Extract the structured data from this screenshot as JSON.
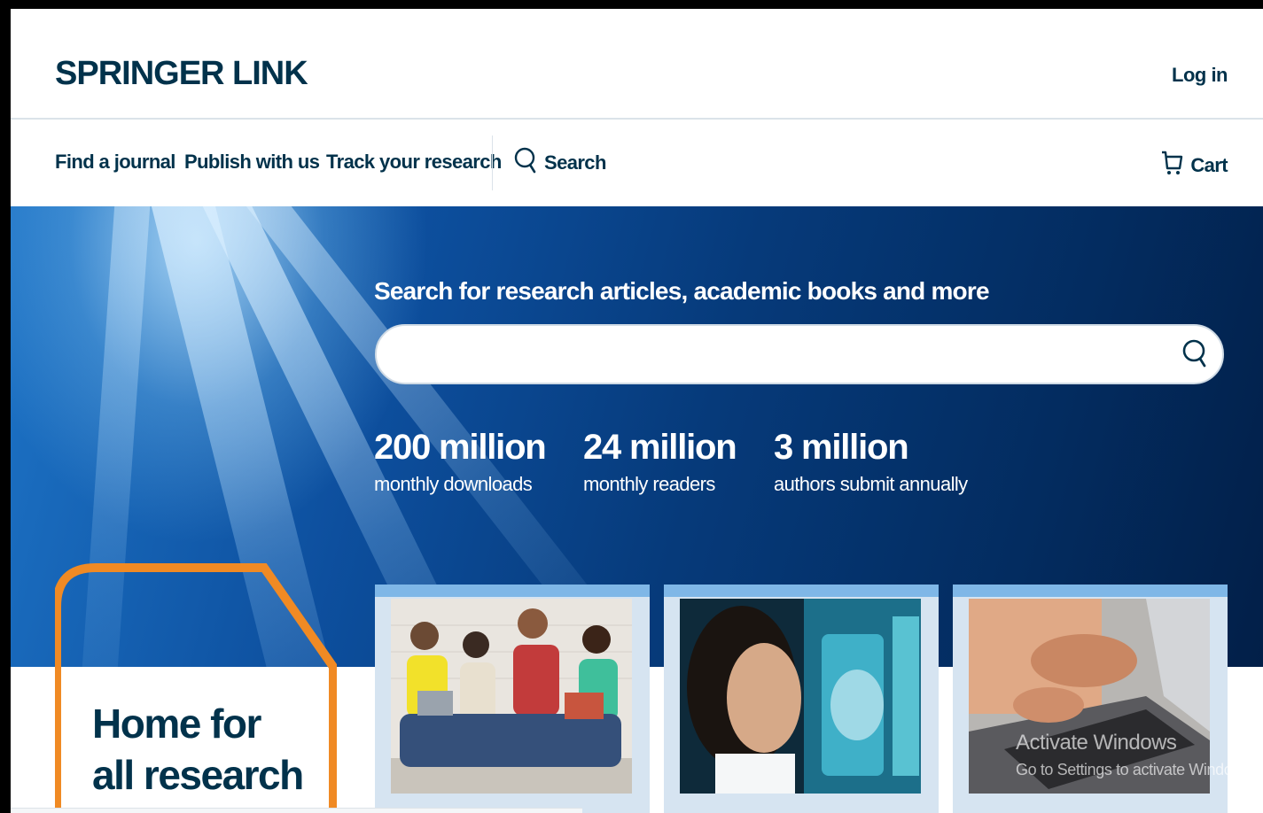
{
  "header": {
    "logo_main": "SPRINGER LINK",
    "login": "Log in"
  },
  "nav": {
    "items": [
      {
        "label": "Find a journal"
      },
      {
        "label": "Publish with us"
      },
      {
        "label": "Track your research"
      }
    ],
    "search_label": "Search",
    "cart_label": "Cart"
  },
  "hero": {
    "title": "Search for research articles, academic books and more",
    "search_value": "",
    "search_placeholder": "",
    "stats": [
      {
        "number": "200 million",
        "label": "monthly downloads"
      },
      {
        "number": "24 million",
        "label": "monthly readers"
      },
      {
        "number": "3 million",
        "label": "authors submit annually"
      }
    ]
  },
  "home": {
    "line1": "Home for",
    "line2": "all research"
  },
  "os_watermark": {
    "line1": "Activate Windows",
    "line2": "Go to Settings to activate Windows."
  },
  "colors": {
    "brand_navy": "#01324b",
    "hero_blue": "#0d4f9e",
    "accent_orange": "#f08a24",
    "card_top": "#7fb7e7"
  },
  "icons": [
    "search-icon",
    "cart-icon"
  ]
}
